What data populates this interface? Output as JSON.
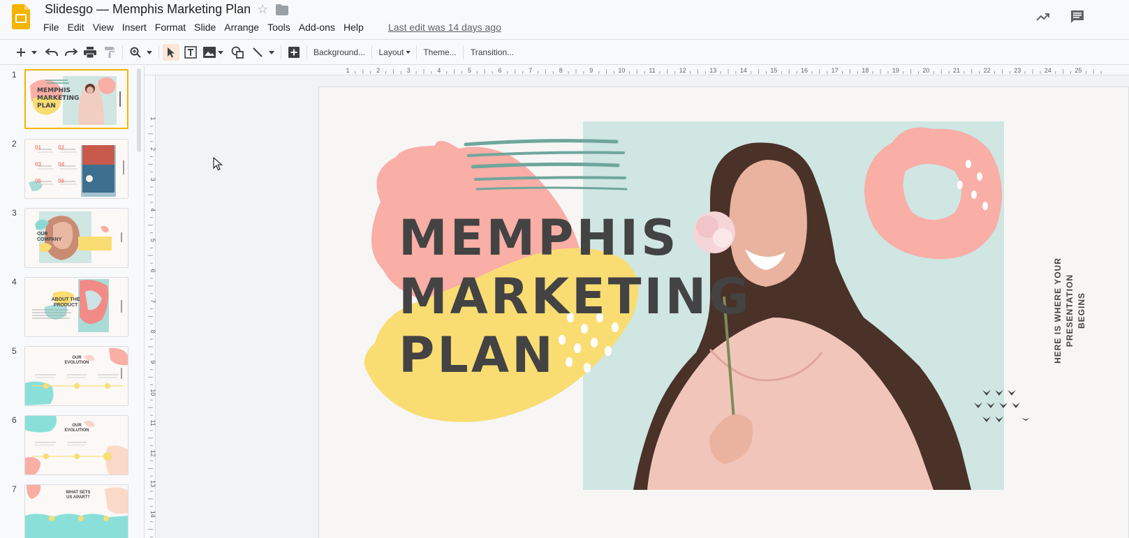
{
  "app": {
    "title": "Slidesgo — Memphis Marketing Plan",
    "last_edit": "Last edit was 14 days ago",
    "menu": [
      "File",
      "Edit",
      "View",
      "Insert",
      "Format",
      "Slide",
      "Arrange",
      "Tools",
      "Add-ons",
      "Help"
    ]
  },
  "toolbar": {
    "background_label": "Background...",
    "layout_label": "Layout",
    "theme_label": "Theme...",
    "transition_label": "Transition..."
  },
  "ruler": {
    "top_ticks": [
      "1",
      "2",
      "3",
      "4",
      "5",
      "6",
      "7",
      "8",
      "9",
      "10",
      "11",
      "12",
      "13",
      "14",
      "15",
      "16",
      "17",
      "18",
      "19",
      "20",
      "21",
      "22",
      "23",
      "24",
      "25"
    ],
    "left_ticks": [
      "1",
      "2",
      "3",
      "4",
      "5",
      "6",
      "7",
      "8",
      "9",
      "10",
      "11",
      "12",
      "13",
      "14"
    ]
  },
  "filmstrip": {
    "slides": [
      {
        "number": "1",
        "title": "MEMPHIS MARKETING PLAN"
      },
      {
        "number": "2",
        "title": ""
      },
      {
        "number": "3",
        "title": "OUR COMPANY"
      },
      {
        "number": "4",
        "title": "ABOUT THE PRODUCT"
      },
      {
        "number": "5",
        "title": "OUR EVOLUTION"
      },
      {
        "number": "6",
        "title": "OUR EVOLUTION"
      },
      {
        "number": "7",
        "title": "WHAT SETS US APART?"
      }
    ],
    "slide2_numbers": [
      "01",
      "02",
      "03",
      "04",
      "05",
      "06"
    ]
  },
  "slide": {
    "title": "MEMPHIS\nMARKETING\nPLAN",
    "side_text": "HERE IS WHERE YOUR\nPRESENTATION BEGINS"
  },
  "colors": {
    "pink": "#f9aea6",
    "yellow": "#f9dd73",
    "teal_bg": "#cfe6e3",
    "teal_stroke": "#6fa69c",
    "text_dark": "#434343",
    "selected_border": "#f4b400",
    "active_tool": "#fde5d7"
  }
}
